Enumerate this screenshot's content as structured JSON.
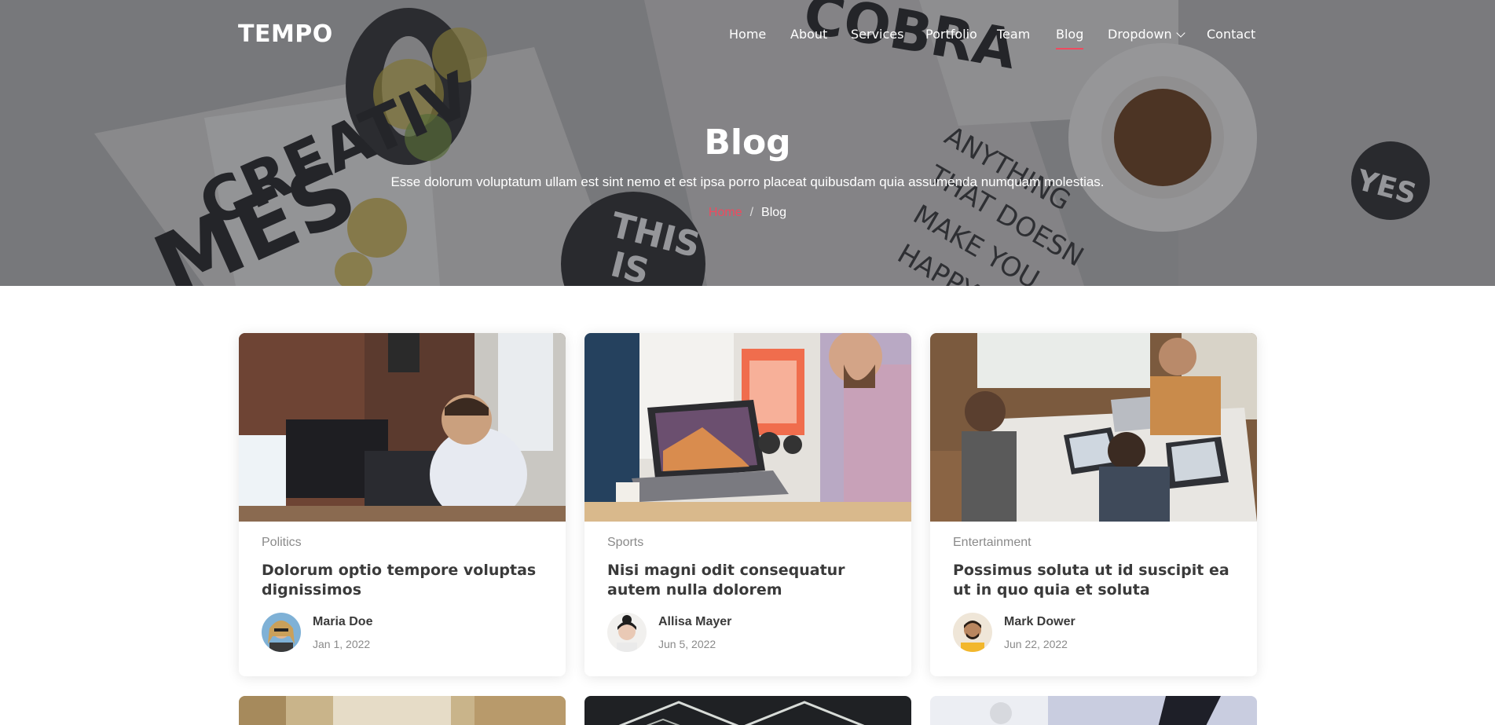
{
  "brand": {
    "logo": "TEMPO",
    "accent": "#ef4a5f"
  },
  "nav": {
    "items": [
      {
        "label": "Home"
      },
      {
        "label": "About"
      },
      {
        "label": "Services"
      },
      {
        "label": "Portfolio"
      },
      {
        "label": "Team"
      },
      {
        "label": "Blog",
        "active": true
      },
      {
        "label": "Dropdown",
        "icon": "chevron-down-icon"
      },
      {
        "label": "Contact"
      }
    ]
  },
  "hero": {
    "title": "Blog",
    "subtitle": "Esse dolorum voluptatum ullam est sint nemo et est ipsa porro placeat quibusdam quia assumenda numquam molestias.",
    "breadcrumb": {
      "home": "Home",
      "separator": "/",
      "current": "Blog"
    }
  },
  "posts": [
    {
      "category": "Politics",
      "title": "Dolorum optio tempore voluptas dignissimos",
      "author": "Maria Doe",
      "date": "Jan 1, 2022"
    },
    {
      "category": "Sports",
      "title": "Nisi magni odit consequatur autem nulla dolorem",
      "author": "Allisa Mayer",
      "date": "Jun 5, 2022"
    },
    {
      "category": "Entertainment",
      "title": "Possimus soluta ut id suscipit ea ut in quo quia et soluta",
      "author": "Mark Dower",
      "date": "Jun 22, 2022"
    }
  ]
}
